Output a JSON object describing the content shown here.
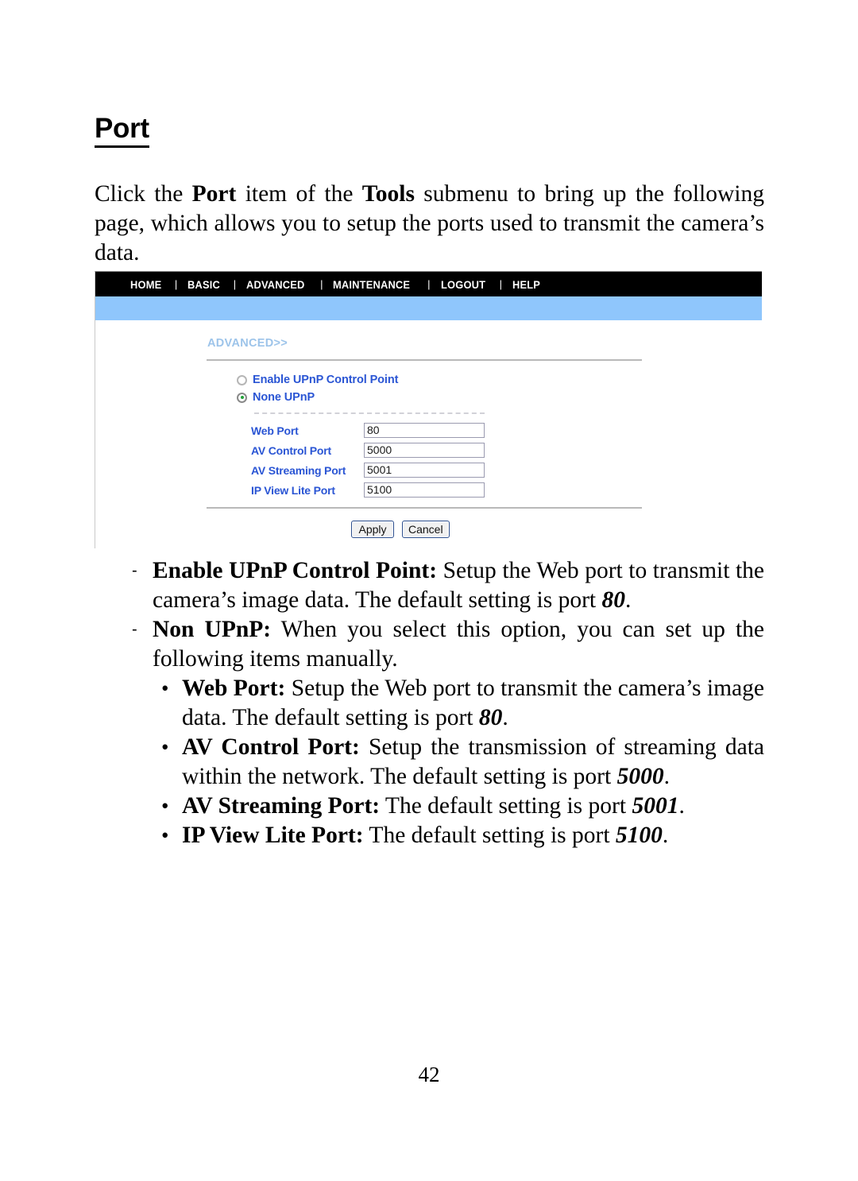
{
  "document": {
    "heading": "Port",
    "intro_parts": {
      "p1": "Click the ",
      "b1": "Port",
      "p2": " item of the ",
      "b2": "Tools",
      "p3": " submenu to bring up the following page, which allows you to setup the ports used to transmit the camera’s data."
    },
    "page_number": "42"
  },
  "screenshot": {
    "navbar": {
      "items": [
        {
          "label": "HOME"
        },
        {
          "label": "BASIC"
        },
        {
          "label": "ADVANCED"
        },
        {
          "label": "MAINTENANCE"
        },
        {
          "label": "LOGOUT"
        },
        {
          "label": "HELP"
        }
      ],
      "separator": "|",
      "background_color": "#000000",
      "text_color": "#ffffff"
    },
    "band_color": "#8fc6fc",
    "breadcrumb": "ADVANCED>>",
    "radios": [
      {
        "label": "Enable UPnP Control Point",
        "selected": false
      },
      {
        "label": "None UPnP",
        "selected": true
      }
    ],
    "selected_radio_dot_color": "#23a23a",
    "label_color": "#2a55d4",
    "fields": [
      {
        "label": "Web Port",
        "value": "80"
      },
      {
        "label": "AV Control Port",
        "value": "5000"
      },
      {
        "label": "AV Streaming Port",
        "value": "5001"
      },
      {
        "label": "IP View Lite Port",
        "value": "5100"
      }
    ],
    "buttons": [
      {
        "label": "Apply"
      },
      {
        "label": "Cancel"
      }
    ]
  },
  "bullets": {
    "items": [
      {
        "level": 1,
        "marker": "-",
        "bold_lead": "Enable UPnP Control Point:",
        "text_a": " Setup the Web port to transmit the camera’s image data.  The default setting is port ",
        "italic": "80",
        "text_b": "."
      },
      {
        "level": 1,
        "marker": "-",
        "bold_lead": "Non UPnP:",
        "text_a": " When you select this option, you can set up the following items manually.",
        "italic": "",
        "text_b": ""
      },
      {
        "level": 2,
        "marker": "•",
        "bold_lead": "Web Port:",
        "text_a": " Setup the Web port to transmit the camera’s image data.  The default setting is port ",
        "italic": "80",
        "text_b": "."
      },
      {
        "level": 2,
        "marker": "•",
        "bold_lead": "AV Control Port:",
        "text_a": " Setup the transmission of streaming data within the network.  The default setting is port ",
        "italic": "5000",
        "text_b": "."
      },
      {
        "level": 2,
        "marker": "•",
        "bold_lead": "AV Streaming Port:",
        "text_a": "  The default setting is port ",
        "italic": "5001",
        "text_b": "."
      },
      {
        "level": 2,
        "marker": "•",
        "bold_lead": "IP View Lite Port:",
        "text_a": "  The default setting is port ",
        "italic": "5100",
        "text_b": "."
      }
    ]
  }
}
